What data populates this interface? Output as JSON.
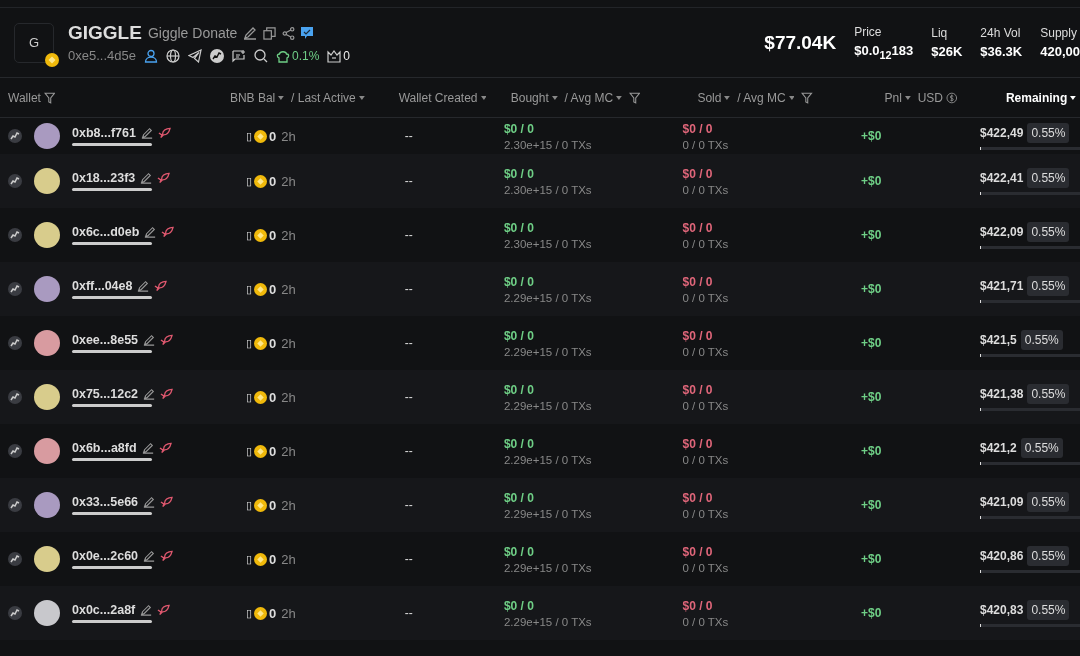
{
  "token": {
    "logo_letter": "G",
    "symbol": "GIGGLE",
    "name": "Giggle Donate",
    "address": "0xe5...4d5e",
    "top10": "0.1%",
    "snipers": "0"
  },
  "stats": {
    "market_cap": "$77.04K",
    "items": [
      {
        "label": "Price",
        "value": "$0.0$_{12}$183"
      },
      {
        "label": "Liq",
        "value": "$26K"
      },
      {
        "label": "24h Vol",
        "value": "$36.3K"
      },
      {
        "label": "Supply",
        "value": "420,00"
      }
    ]
  },
  "columns": [
    {
      "label": "Wallet",
      "kind": "filter",
      "selected": false
    },
    {
      "label": "BNB Bal",
      "kind": "sort",
      "selected": false
    },
    {
      "label": "/ Last Active",
      "kind": "sort",
      "selected": false
    },
    {
      "label": "Wallet Created",
      "kind": "sort",
      "selected": false
    },
    {
      "label": "Bought",
      "kind": "sort",
      "selected": false
    },
    {
      "label": "/ Avg MC",
      "kind": "sortfilter",
      "selected": false
    },
    {
      "label": "Sold",
      "kind": "sort",
      "selected": false
    },
    {
      "label": "/ Avg MC",
      "kind": "sortfilter",
      "selected": false
    },
    {
      "label": "Pnl",
      "kind": "sort",
      "selected": false
    },
    {
      "label": "USD",
      "kind": "currency",
      "selected": false
    },
    {
      "label": "Remaining",
      "kind": "sort",
      "selected": true
    }
  ],
  "rows": [
    {
      "wallet": "0xb8...f761",
      "color": "#a99ac0",
      "missing": "▯",
      "balance": "0",
      "active": "2h",
      "created": "--",
      "bought": "$0 / 0",
      "bought_sub": "2.30e+15 / 0 TXs",
      "sold": "$0 / 0",
      "sold_sub": "0 / 0 TXs",
      "pnl": "+$0",
      "remaining": "$422,49",
      "pct": "0.55%",
      "level": 0.01
    },
    {
      "wallet": "0x18...23f3",
      "color": "#d8cc8c",
      "missing": "▯",
      "balance": "0",
      "active": "2h",
      "created": "--",
      "bought": "$0 / 0",
      "bought_sub": "2.30e+15 / 0 TXs",
      "sold": "$0 / 0",
      "sold_sub": "0 / 0 TXs",
      "pnl": "+$0",
      "remaining": "$422,41",
      "pct": "0.55%",
      "level": 0.01
    },
    {
      "wallet": "0x6c...d0eb",
      "color": "#d8cc8c",
      "missing": "▯",
      "balance": "0",
      "active": "2h",
      "created": "--",
      "bought": "$0 / 0",
      "bought_sub": "2.30e+15 / 0 TXs",
      "sold": "$0 / 0",
      "sold_sub": "0 / 0 TXs",
      "pnl": "+$0",
      "remaining": "$422,09",
      "pct": "0.55%",
      "level": 0.01
    },
    {
      "wallet": "0xff...04e8",
      "color": "#a99ac0",
      "missing": "▯",
      "balance": "0",
      "active": "2h",
      "created": "--",
      "bought": "$0 / 0",
      "bought_sub": "2.29e+15 / 0 TXs",
      "sold": "$0 / 0",
      "sold_sub": "0 / 0 TXs",
      "pnl": "+$0",
      "remaining": "$421,71",
      "pct": "0.55%",
      "level": 0.01
    },
    {
      "wallet": "0xee...8e55",
      "color": "#d89ba0",
      "missing": "▯",
      "balance": "0",
      "active": "2h",
      "created": "--",
      "bought": "$0 / 0",
      "bought_sub": "2.29e+15 / 0 TXs",
      "sold": "$0 / 0",
      "sold_sub": "0 / 0 TXs",
      "pnl": "+$0",
      "remaining": "$421,5",
      "pct": "0.55%",
      "level": 0.01
    },
    {
      "wallet": "0x75...12c2",
      "color": "#d8cc8c",
      "missing": "▯",
      "balance": "0",
      "active": "2h",
      "created": "--",
      "bought": "$0 / 0",
      "bought_sub": "2.29e+15 / 0 TXs",
      "sold": "$0 / 0",
      "sold_sub": "0 / 0 TXs",
      "pnl": "+$0",
      "remaining": "$421,38",
      "pct": "0.55%",
      "level": 0.01
    },
    {
      "wallet": "0x6b...a8fd",
      "color": "#d89ba0",
      "missing": "▯",
      "balance": "0",
      "active": "2h",
      "created": "--",
      "bought": "$0 / 0",
      "bought_sub": "2.29e+15 / 0 TXs",
      "sold": "$0 / 0",
      "sold_sub": "0 / 0 TXs",
      "pnl": "+$0",
      "remaining": "$421,2",
      "pct": "0.55%",
      "level": 0.01
    },
    {
      "wallet": "0x33...5e66",
      "color": "#a99ac0",
      "missing": "▯",
      "balance": "0",
      "active": "2h",
      "created": "--",
      "bought": "$0 / 0",
      "bought_sub": "2.29e+15 / 0 TXs",
      "sold": "$0 / 0",
      "sold_sub": "0 / 0 TXs",
      "pnl": "+$0",
      "remaining": "$421,09",
      "pct": "0.55%",
      "level": 0.01
    },
    {
      "wallet": "0x0e...2c60",
      "color": "#d8cc8c",
      "missing": "▯",
      "balance": "0",
      "active": "2h",
      "created": "--",
      "bought": "$0 / 0",
      "bought_sub": "2.29e+15 / 0 TXs",
      "sold": "$0 / 0",
      "sold_sub": "0 / 0 TXs",
      "pnl": "+$0",
      "remaining": "$420,86",
      "pct": "0.55%",
      "level": 0.01
    },
    {
      "wallet": "0x0c...2a8f",
      "color": "#c8c8cc",
      "missing": "▯",
      "balance": "0",
      "active": "2h",
      "created": "--",
      "bought": "$0 / 0",
      "bought_sub": "2.29e+15 / 0 TXs",
      "sold": "$0 / 0",
      "sold_sub": "0 / 0 TXs",
      "pnl": "+$0",
      "remaining": "$420,83",
      "pct": "0.55%",
      "level": 0.01
    }
  ]
}
